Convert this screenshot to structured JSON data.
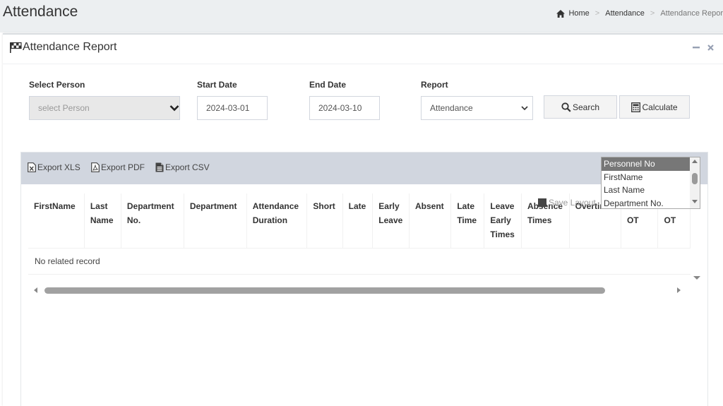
{
  "page": {
    "title": "Attendance"
  },
  "breadcrumb": {
    "home": "Home",
    "section": "Attendance",
    "current": "Attendance Repor"
  },
  "panel": {
    "title": "Attendance Report",
    "minimize_icon": "minus-icon",
    "close_icon": "close-icon"
  },
  "filters": {
    "person": {
      "label": "Select Person",
      "placeholder": "select Person"
    },
    "start_date": {
      "label": "Start Date",
      "value": "2024-03-01"
    },
    "end_date": {
      "label": "End Date",
      "value": "2024-03-10"
    },
    "report": {
      "label": "Report",
      "value": "Attendance"
    }
  },
  "buttons": {
    "search": "Search",
    "calculate": "Calculate"
  },
  "exports": {
    "xls": "Export XLS",
    "pdf": "Export PDF",
    "csv": "Export CSV"
  },
  "column_chooser": {
    "options": [
      "Personnel No",
      "FirstName",
      "Last Name",
      "Department No."
    ],
    "selected": "Personnel No"
  },
  "save_layout": "Save Layout",
  "table": {
    "columns": [
      "FirstName",
      "Last Name",
      "Department No.",
      "Department",
      "Attendance Duration",
      "Short",
      "Late",
      "Early Leave",
      "Absent",
      "Late Time",
      "Leave Early Times",
      "Absence Times",
      "Overtime",
      "OT",
      "OT"
    ],
    "empty_message": "No related record"
  },
  "colors": {
    "topbar_bg": "#eceff1",
    "toolbar_bg": "#d1d6df",
    "selected_option_bg": "#777777",
    "disabled_input_bg": "#e8e8e8"
  }
}
